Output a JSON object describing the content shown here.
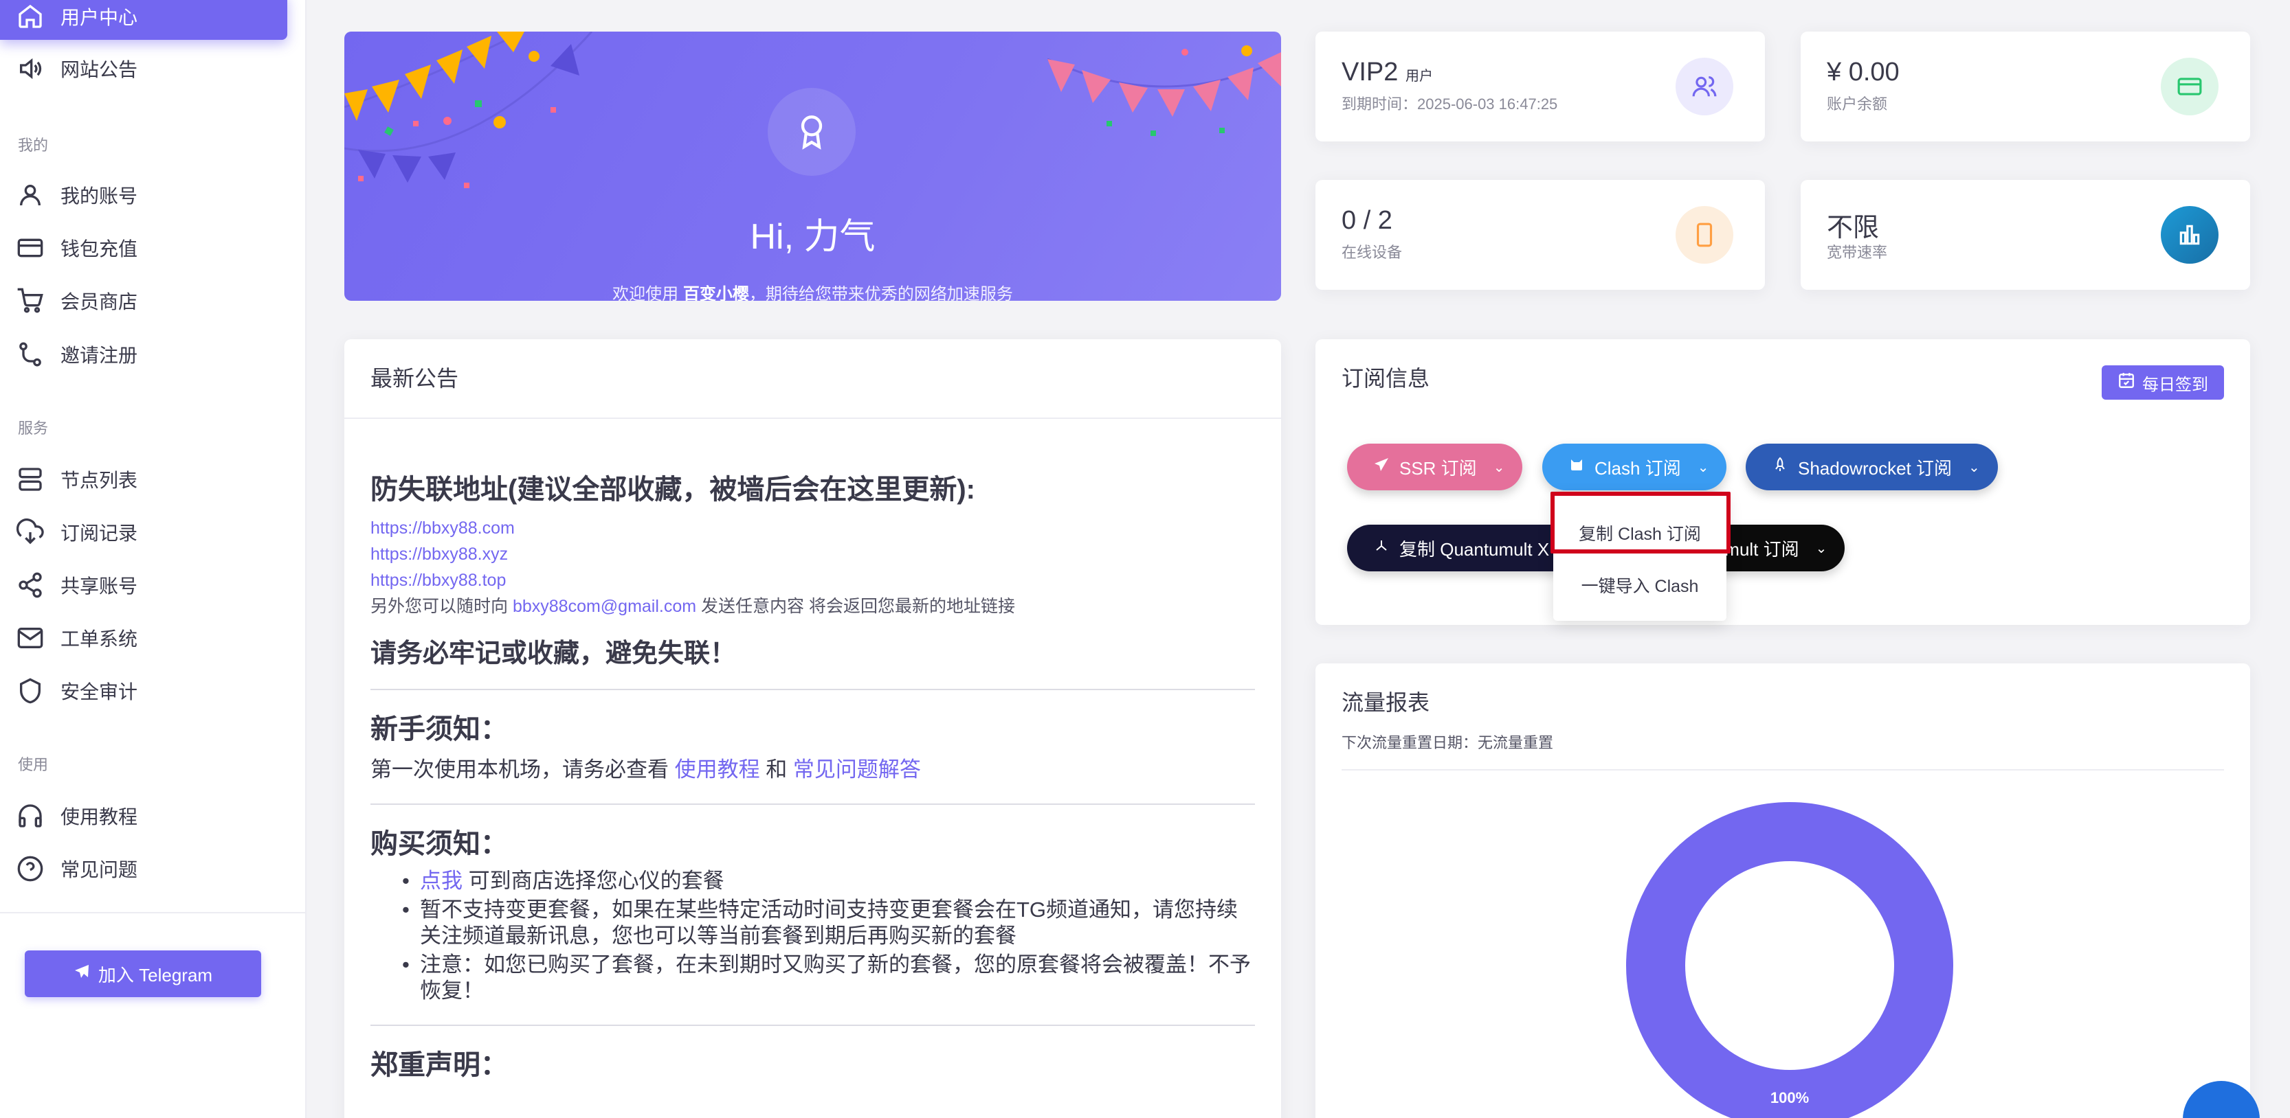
{
  "sidebar": {
    "items": [
      {
        "label": "用户中心",
        "icon": "home-icon"
      },
      {
        "label": "网站公告",
        "icon": "megaphone-icon"
      },
      {
        "label": "我的账号",
        "icon": "user-icon"
      },
      {
        "label": "钱包充值",
        "icon": "credit-card-icon"
      },
      {
        "label": "会员商店",
        "icon": "cart-icon"
      },
      {
        "label": "邀请注册",
        "icon": "invite-icon"
      },
      {
        "label": "节点列表",
        "icon": "server-icon"
      },
      {
        "label": "订阅记录",
        "icon": "cloud-download-icon"
      },
      {
        "label": "共享账号",
        "icon": "share-icon"
      },
      {
        "label": "工单系统",
        "icon": "mail-icon"
      },
      {
        "label": "安全审计",
        "icon": "shield-icon"
      },
      {
        "label": "使用教程",
        "icon": "headphones-icon"
      },
      {
        "label": "常见问题",
        "icon": "help-circle-icon"
      }
    ],
    "sections": {
      "mine": "我的",
      "service": "服务",
      "use": "使用"
    },
    "telegram_button": "加入 Telegram"
  },
  "welcome": {
    "title": "Hi, 力气",
    "subtitle_prefix": "欢迎使用 ",
    "site_name": "百变小樱",
    "subtitle_suffix": "，期待给您带来优秀的网络加速服务"
  },
  "stats": {
    "vip": {
      "level": "VIP2",
      "unit": "用户",
      "label": "到期时间：2025-06-03 16:47:25"
    },
    "balance": {
      "value": "¥ 0.00",
      "label": "账户余额"
    },
    "devices": {
      "value": "0 / 2",
      "label": "在线设备"
    },
    "bandwidth": {
      "value": "不限",
      "label": "宽带速率"
    }
  },
  "announcement": {
    "header": "最新公告",
    "heading": "防失联地址(建议全部收藏，被墙后会在这里更新):",
    "links": [
      "https://bbxy88.com",
      "https://bbxy88.xyz",
      "https://bbxy88.top"
    ],
    "mail_prefix": "另外您可以随时向 ",
    "mail": "bbxy88com@gmail.com",
    "mail_suffix": " 发送任意内容 将会返回您最新的地址链接",
    "remember": "请务必牢记或收藏，避免失联！",
    "newbie_title": "新手须知：",
    "newbie_prefix": "第一次使用本机场，请务必查看 ",
    "newbie_link1": "使用教程",
    "newbie_and": " 和 ",
    "newbie_link2": "常见问题解答",
    "buy_title": "购买须知：",
    "buy_items": [
      {
        "link": "点我",
        "text": " 可到商店选择您心仪的套餐"
      },
      {
        "link": "",
        "text": "暂不支持变更套餐，如果在某些特定活动时间支持变更套餐会在TG频道通知，请您持续关注频道最新讯息，您也可以等当前套餐到期后再购买新的套餐"
      },
      {
        "link": "",
        "text": "注意：如您已购买了套餐，在未到期时又购买了新的套餐，您的原套餐将会被覆盖！不予恢复！"
      }
    ],
    "notice_title": "郑重声明："
  },
  "subscription": {
    "header": "订阅信息",
    "checkin": "每日签到",
    "buttons": [
      {
        "label": "SSR 订阅",
        "color": "#e5709b"
      },
      {
        "label": "Clash 订阅",
        "color": "#3a9cf2"
      },
      {
        "label": "Shadowrocket 订阅",
        "color": "#2d5cb6"
      },
      {
        "label": "复制 Quantumult X",
        "color": "#151535"
      },
      {
        "label": "Quantumult 订阅",
        "color": "#0b0b0b"
      }
    ],
    "dropdown": [
      "复制 Clash 订阅",
      "一键导入 Clash"
    ]
  },
  "traffic": {
    "header": "流量报表",
    "reset": "下次流量重置日期：无流量重置"
  },
  "chart_data": {
    "type": "pie",
    "categories": [
      ""
    ],
    "values": [
      100
    ],
    "data_labels": [
      "100%"
    ],
    "colors": [
      "#7367f0"
    ]
  },
  "colors": {
    "accent": "#7367f0"
  }
}
